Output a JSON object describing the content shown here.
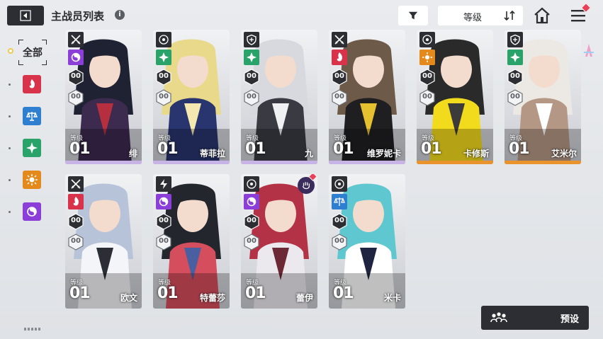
{
  "header": {
    "title": "主战员列表",
    "info": "i",
    "sort_label": "等级"
  },
  "sidebar": {
    "all_label": "全部",
    "elements": [
      {
        "name": "burn",
        "color": "#d8334b"
      },
      {
        "name": "balance",
        "color": "#2e7fd0"
      },
      {
        "name": "wind",
        "color": "#2aa36b"
      },
      {
        "name": "sun",
        "color": "#e48a1c"
      },
      {
        "name": "void",
        "color": "#8b3fd8"
      }
    ]
  },
  "cards": [
    {
      "name": "绯",
      "class": "sword",
      "element": "void",
      "rank1": "00",
      "rank2": "00",
      "level_label": "等级",
      "level": "01",
      "bar": "#c7b3e6"
    },
    {
      "name": "蒂菲拉",
      "class": "target",
      "element": "wind",
      "rank1": "00",
      "rank2": "00",
      "level_label": "等级",
      "level": "01",
      "bar": "#c7b3e6"
    },
    {
      "name": "九",
      "class": "shield",
      "element": "wind",
      "rank1": "00",
      "rank2": "00",
      "level_label": "等级",
      "level": "01",
      "bar": "#c7b3e6"
    },
    {
      "name": "维罗妮卡",
      "class": "sword",
      "element": "burn",
      "rank1": "00",
      "rank2": "00",
      "level_label": "等级",
      "level": "01",
      "bar": "#c7b3e6"
    },
    {
      "name": "卡修斯",
      "class": "target",
      "element": "sun",
      "rank1": "00",
      "rank2": "00",
      "level_label": "等级",
      "level": "01",
      "bar": "#e8932c"
    },
    {
      "name": "艾米尔",
      "class": "shield",
      "element": "wind",
      "rank1": "00",
      "rank2": "00",
      "level_label": "等级",
      "level": "01",
      "bar": "#e8932c"
    },
    {
      "name": "欧文",
      "class": "sword",
      "element": "burn",
      "rank1": "00",
      "rank2": "00",
      "level_label": "等级",
      "level": "01",
      "bar": ""
    },
    {
      "name": "特蕾莎",
      "class": "bolt",
      "element": "void",
      "rank1": "00",
      "rank2": "00",
      "level_label": "等级",
      "level": "01",
      "bar": ""
    },
    {
      "name": "蕾伊",
      "class": "target",
      "element": "void",
      "rank1": "00",
      "rank2": "00",
      "level_label": "等级",
      "level": "01",
      "bar": ""
    },
    {
      "name": "米卡",
      "class": "target",
      "element": "balance",
      "rank1": "00",
      "rank2": "00",
      "level_label": "等级",
      "level": "01",
      "bar": ""
    }
  ],
  "footer": {
    "preset_label": "预设"
  },
  "colors": {
    "dark": "#2c2e33",
    "accent_red": "#e8415a"
  }
}
